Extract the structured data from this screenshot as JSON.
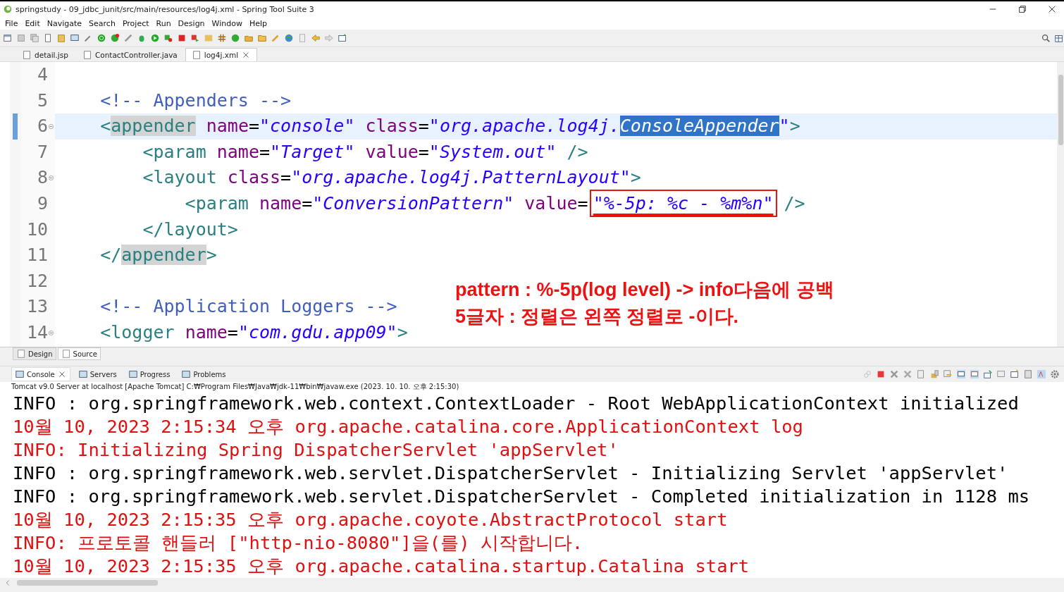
{
  "window": {
    "title": "springstudy - 09_jdbc_junit/src/main/resources/log4j.xml - Spring Tool Suite 3"
  },
  "menu": [
    "File",
    "Edit",
    "Navigate",
    "Search",
    "Project",
    "Run",
    "Design",
    "Window",
    "Help"
  ],
  "editor_tabs": [
    {
      "label": "detail.jsp",
      "selected": false
    },
    {
      "label": "ContactController.java",
      "selected": false
    },
    {
      "label": "log4j.xml",
      "selected": true
    }
  ],
  "code_lines": [
    {
      "number": "4",
      "foldable": false,
      "current": false
    },
    {
      "number": "5",
      "foldable": false,
      "current": false,
      "tokens": [
        {
          "text": "    <!-- Appenders -->",
          "kind": "comment"
        }
      ]
    },
    {
      "number": "6",
      "foldable": true,
      "current": true,
      "tokens": [
        {
          "text": "    <",
          "kind": "tag"
        },
        {
          "text": "appender",
          "kind": "tag-occurrence"
        },
        {
          "text": " name",
          "kind": "attr"
        },
        {
          "text": "=",
          "kind": "punct"
        },
        {
          "text": "\"console\"",
          "kind": "value"
        },
        {
          "text": " class",
          "kind": "attr"
        },
        {
          "text": "=",
          "kind": "punct"
        },
        {
          "text": "\"org.apache.log4j.",
          "kind": "value"
        },
        {
          "text": "ConsoleAppender",
          "kind": "value-selected"
        },
        {
          "text": "\"",
          "kind": "value"
        },
        {
          "text": ">",
          "kind": "tag"
        }
      ]
    },
    {
      "number": "7",
      "foldable": false,
      "current": false,
      "tokens": [
        {
          "text": "        <param",
          "kind": "tag"
        },
        {
          "text": " name",
          "kind": "attr"
        },
        {
          "text": "=",
          "kind": "punct"
        },
        {
          "text": "\"Target\"",
          "kind": "value"
        },
        {
          "text": " value",
          "kind": "attr"
        },
        {
          "text": "=",
          "kind": "punct"
        },
        {
          "text": "\"System.out\"",
          "kind": "value"
        },
        {
          "text": " />",
          "kind": "tag"
        }
      ]
    },
    {
      "number": "8",
      "foldable": true,
      "current": false,
      "tokens": [
        {
          "text": "        <layout",
          "kind": "tag"
        },
        {
          "text": " class",
          "kind": "attr"
        },
        {
          "text": "=",
          "kind": "punct"
        },
        {
          "text": "\"org.apache.log4j.PatternLayout\"",
          "kind": "value"
        },
        {
          "text": ">",
          "kind": "tag"
        }
      ]
    },
    {
      "number": "9",
      "foldable": false,
      "current": false,
      "tokens": [
        {
          "text": "            <param",
          "kind": "tag"
        },
        {
          "text": " name",
          "kind": "attr"
        },
        {
          "text": "=",
          "kind": "punct"
        },
        {
          "text": "\"ConversionPattern\"",
          "kind": "value"
        },
        {
          "text": " value",
          "kind": "attr"
        },
        {
          "text": "=",
          "kind": "punct"
        },
        {
          "text": "\"%-5p: %c - %m%n\"",
          "kind": "value-marked"
        },
        {
          "text": " />",
          "kind": "tag"
        }
      ]
    },
    {
      "number": "10",
      "foldable": false,
      "current": false,
      "tokens": [
        {
          "text": "        </layout>",
          "kind": "tag"
        }
      ]
    },
    {
      "number": "11",
      "foldable": false,
      "current": false,
      "tokens": [
        {
          "text": "    </",
          "kind": "tag"
        },
        {
          "text": "appender",
          "kind": "tag-occurrence"
        },
        {
          "text": ">",
          "kind": "tag"
        }
      ]
    },
    {
      "number": "12",
      "foldable": false,
      "current": false
    },
    {
      "number": "13",
      "foldable": false,
      "current": false,
      "tokens": [
        {
          "text": "    <!-- Application Loggers -->",
          "kind": "comment"
        }
      ]
    },
    {
      "number": "14",
      "foldable": true,
      "current": false,
      "tokens": [
        {
          "text": "    <logger",
          "kind": "tag"
        },
        {
          "text": " name",
          "kind": "attr"
        },
        {
          "text": "=",
          "kind": "punct"
        },
        {
          "text": "\"com.gdu.app09\"",
          "kind": "value"
        },
        {
          "text": ">",
          "kind": "tag"
        }
      ]
    }
  ],
  "annotation_note": [
    "pattern : %-5p(log level) -> info다음에 공백",
    "5글자 : 정렬은 왼쪽 정렬로 -이다."
  ],
  "editor_mode_tabs": [
    {
      "label": "Design",
      "selected": false
    },
    {
      "label": "Source",
      "selected": true
    }
  ],
  "console_tabs": [
    {
      "label": "Console",
      "selected": true
    },
    {
      "label": "Servers",
      "selected": false
    },
    {
      "label": "Progress",
      "selected": false
    },
    {
      "label": "Problems",
      "selected": false
    }
  ],
  "console_header": "Tomcat v9.0 Server at localhost [Apache Tomcat] C:₩Program Files₩Java₩jdk-11₩bin₩javaw.exe  (2023. 10. 10. 오후 2:15:30)",
  "console_lines": [
    {
      "text": "INFO : org.springframework.web.context.ContextLoader - Root WebApplicationContext initialized",
      "kind": "stdout"
    },
    {
      "text": "10월 10, 2023 2:15:34 오후 org.apache.catalina.core.ApplicationContext log",
      "kind": "stderr"
    },
    {
      "text": "INFO: Initializing Spring DispatcherServlet 'appServlet'",
      "kind": "stderr"
    },
    {
      "text": "INFO : org.springframework.web.servlet.DispatcherServlet - Initializing Servlet 'appServlet'",
      "kind": "stdout"
    },
    {
      "text": "INFO : org.springframework.web.servlet.DispatcherServlet - Completed initialization in 1128 ms",
      "kind": "stdout"
    },
    {
      "text": "10월 10, 2023 2:15:35 오후 org.apache.coyote.AbstractProtocol start",
      "kind": "stderr"
    },
    {
      "text": "INFO: 프로토콜 핸들러 [\"http-nio-8080\"]을(를) 시작합니다.",
      "kind": "stderr"
    },
    {
      "text": "10월 10, 2023 2:15:35 오후 org.apache.catalina.startup.Catalina start",
      "kind": "stderr"
    }
  ]
}
